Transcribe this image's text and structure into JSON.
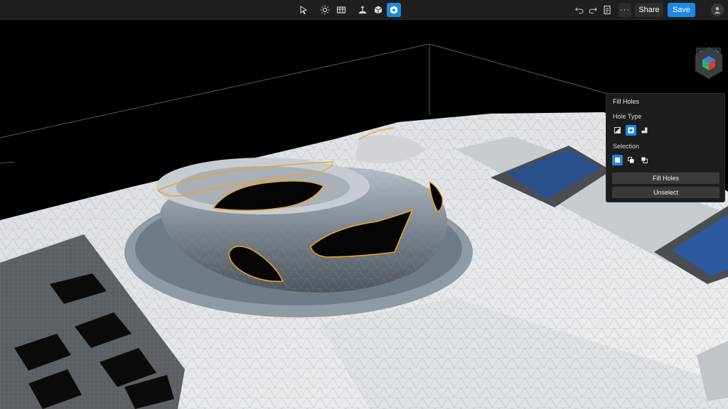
{
  "toolbar": {
    "tools": [
      {
        "icon": "select-arrow-icon",
        "active": false
      },
      {
        "icon": "sun-light-icon",
        "active": false
      },
      {
        "icon": "grid-layers-icon",
        "active": false
      },
      {
        "icon": "ground-plane-icon",
        "active": false
      },
      {
        "icon": "model-cube-icon",
        "active": false
      },
      {
        "icon": "fill-holes-tool-icon",
        "active": true
      }
    ],
    "undo_icon": "undo-icon",
    "redo_icon": "redo-icon",
    "notes_icon": "document-icon",
    "more_label": "···",
    "share_label": "Share",
    "save_label": "Save",
    "avatar_icon": "user-avatar-icon"
  },
  "viewport": {
    "view_buttons": [
      "solid-cube-icon",
      "wireframe-cube-icon"
    ],
    "orientation_icon": "orientation-cube-icon"
  },
  "panel": {
    "title": "Fill Holes",
    "hole_type_label": "Hole Type",
    "hole_type_options": [
      "edge-hole-icon",
      "interior-hole-icon",
      "corner-hole-icon"
    ],
    "hole_type_selected": 1,
    "selection_label": "Selection",
    "selection_options": [
      "select-single-icon",
      "select-add-icon",
      "select-subtract-icon"
    ],
    "selection_selected": 0,
    "fill_button": "Fill Holes",
    "unselect_button": "Unselect"
  },
  "colors": {
    "accent": "#1e88e5",
    "hole_outline": "#f0a020",
    "topbar": "#1f1f1f",
    "panel": "#1d1d1d"
  }
}
